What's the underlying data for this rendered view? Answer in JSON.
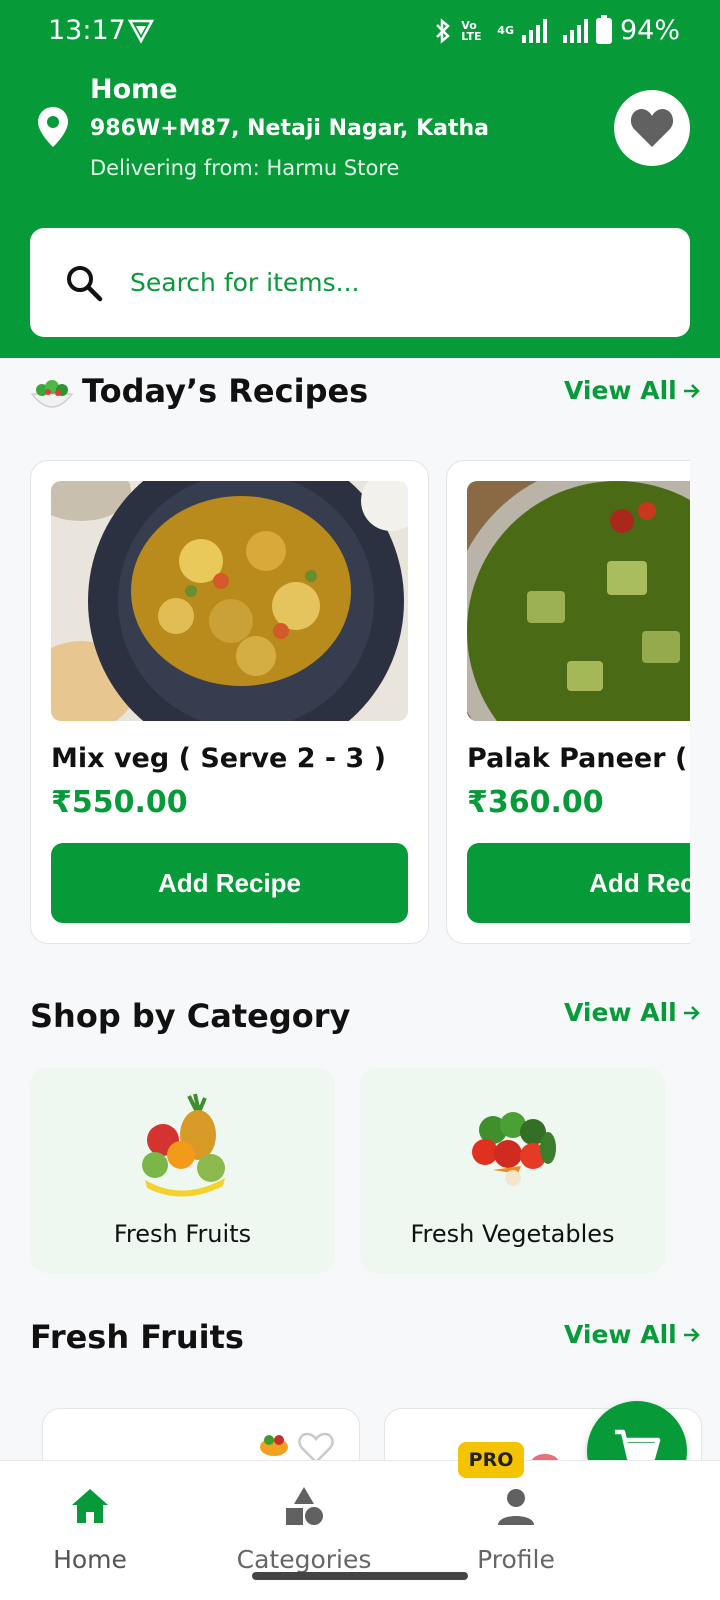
{
  "status_bar": {
    "time": "13:17",
    "volte_label": "Vo LTE",
    "net_label": "4G",
    "battery": "94%"
  },
  "location": {
    "title": "Home",
    "address": "986W+M87, Netaji Nagar, Katha...",
    "delivering": "Delivering from: Harmu Store"
  },
  "search": {
    "placeholder": "Search for items..."
  },
  "recipes": {
    "title": "Today’s Recipes",
    "view_all": "View All",
    "items": [
      {
        "name": "Mix veg ( Serve 2 - 3 )",
        "price": "₹550.00",
        "button": "Add Recipe"
      },
      {
        "name": "Palak Paneer ( S",
        "price": "₹360.00",
        "button": "Add Reci"
      }
    ]
  },
  "categories": {
    "title": "Shop by Category",
    "view_all": "View All",
    "items": [
      {
        "label": "Fresh Fruits"
      },
      {
        "label": "Fresh Vegetables"
      }
    ]
  },
  "fresh_fruits": {
    "title": "Fresh Fruits",
    "view_all": "View All"
  },
  "bottom_nav": {
    "items": [
      {
        "label": "Home"
      },
      {
        "label": "Categories"
      },
      {
        "label": "Profile"
      }
    ],
    "pro_badge": "PRO"
  },
  "colors": {
    "brand_green": "#079a39",
    "category_bg": "#eef8f1",
    "pro_yellow": "#f5c400"
  },
  "icons": [
    "location-pin-icon",
    "heart-icon",
    "search-icon",
    "salad-icon",
    "arrow-right-icon",
    "cart-icon",
    "home-icon",
    "categories-icon",
    "profile-icon"
  ]
}
